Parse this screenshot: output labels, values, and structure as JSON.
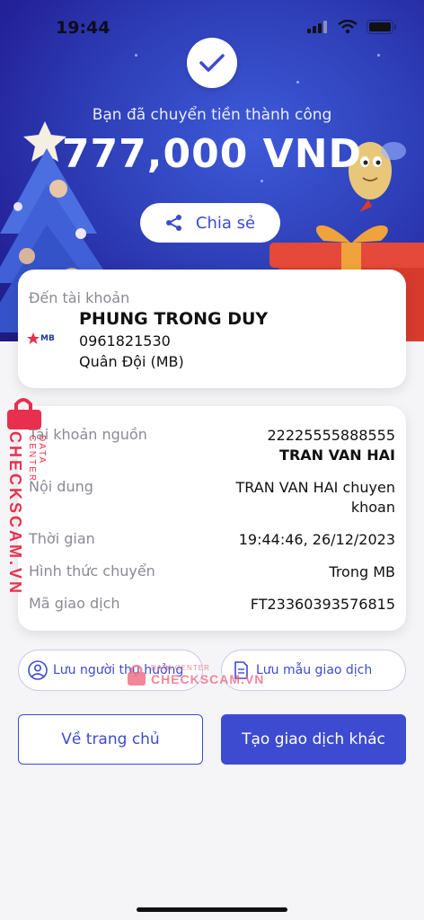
{
  "status_bar": {
    "time": "19:44"
  },
  "hero": {
    "success_message": "Bạn đã chuyển tiền thành công",
    "amount": "777,000 VND",
    "share_label": "Chia sẻ"
  },
  "destination": {
    "label": "Đến tài khoản",
    "bank_logo_text": "MB",
    "name": "PHUNG TRONG DUY",
    "account_number": "0961821530",
    "bank_name": "Quân Đội (MB)"
  },
  "details": {
    "source_account_label": "Tài khoản nguồn",
    "source_account_number": "22225555888555",
    "source_account_name": "TRAN VAN HAI",
    "content_label": "Nội dung",
    "content_line1": "TRAN VAN HAI chuyen",
    "content_line2": "khoan",
    "time_label": "Thời gian",
    "time_value": "19:44:46, 26/12/2023",
    "method_label": "Hình thức chuyển",
    "method_value": "Trong MB",
    "transaction_code_label": "Mã giao dịch",
    "transaction_code_value": "FT23360393576815"
  },
  "actions": {
    "save_payee": "Lưu người thụ hưởng",
    "save_template": "Lưu mẫu giao dịch",
    "home": "Về trang chủ",
    "new_transaction": "Tạo giao dịch khác"
  },
  "watermark": {
    "brand": "CHECKSCAM.VN",
    "sub": "DATA CENTER"
  },
  "colors": {
    "accent": "#3d4bd1",
    "hero_bg": "#2e3fb8",
    "watermark": "#e8304e"
  }
}
